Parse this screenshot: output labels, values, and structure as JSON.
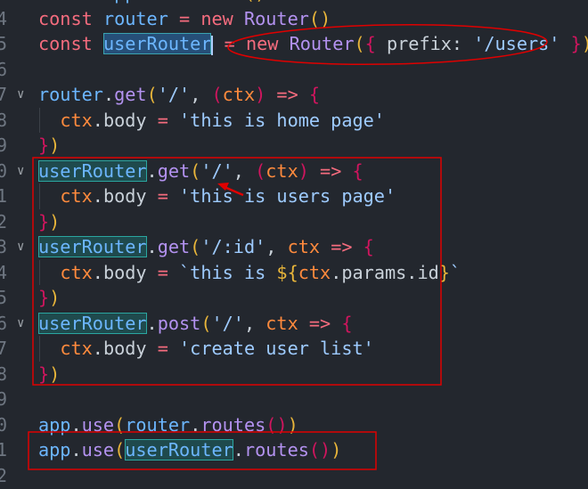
{
  "editor": {
    "lines": [
      {
        "n": "3",
        "fold": false,
        "guide": false,
        "tokens": [
          [
            "const",
            "kw"
          ],
          [
            " ",
            "pn"
          ],
          [
            "app",
            "id"
          ],
          [
            " = ",
            "op"
          ],
          [
            "new",
            "kw"
          ],
          [
            " ",
            "pn"
          ],
          [
            "Koa",
            "cls"
          ],
          [
            "(",
            "br1"
          ],
          [
            ")",
            "br1"
          ]
        ]
      },
      {
        "n": "4",
        "fold": false,
        "guide": false,
        "tokens": [
          [
            "const",
            "kw"
          ],
          [
            " ",
            "pn"
          ],
          [
            "router",
            "id"
          ],
          [
            " = ",
            "op"
          ],
          [
            "new",
            "kw"
          ],
          [
            " ",
            "pn"
          ],
          [
            "Router",
            "cls"
          ],
          [
            "(",
            "br1"
          ],
          [
            ")",
            "br1"
          ]
        ]
      },
      {
        "n": "5",
        "fold": false,
        "guide": false,
        "tokens": [
          [
            "const",
            "kw"
          ],
          [
            " ",
            "pn"
          ],
          [
            "userRouter",
            "id sel"
          ],
          [
            "",
            "cursor"
          ],
          [
            " = ",
            "op"
          ],
          [
            "new",
            "kw"
          ],
          [
            " ",
            "pn"
          ],
          [
            "Router",
            "cls"
          ],
          [
            "(",
            "br1"
          ],
          [
            "{",
            "br2"
          ],
          [
            " prefix: ",
            "prop"
          ],
          [
            "'/users'",
            "str"
          ],
          [
            " ",
            "pn"
          ],
          [
            "}",
            "br2"
          ],
          [
            ")",
            "br1"
          ]
        ]
      },
      {
        "n": "6",
        "fold": false,
        "guide": false,
        "tokens": []
      },
      {
        "n": "7",
        "fold": true,
        "guide": false,
        "tokens": [
          [
            "router",
            "id"
          ],
          [
            ".",
            "pn"
          ],
          [
            "get",
            "fn"
          ],
          [
            "(",
            "br1"
          ],
          [
            "'/'",
            "str"
          ],
          [
            ", ",
            "pn"
          ],
          [
            "(",
            "br2"
          ],
          [
            "ctx",
            "par"
          ],
          [
            ")",
            "br2"
          ],
          [
            " => ",
            "op"
          ],
          [
            "{",
            "br2"
          ]
        ]
      },
      {
        "n": "8",
        "fold": false,
        "guide": true,
        "tokens": [
          [
            "  ",
            "pn"
          ],
          [
            "ctx",
            "par"
          ],
          [
            ".",
            "pn"
          ],
          [
            "body",
            "prop"
          ],
          [
            " = ",
            "op"
          ],
          [
            "'this is home page'",
            "str"
          ]
        ]
      },
      {
        "n": "9",
        "fold": false,
        "guide": false,
        "tokens": [
          [
            "}",
            "br2"
          ],
          [
            ")",
            "br1"
          ]
        ]
      },
      {
        "n": "10",
        "fold": true,
        "guide": false,
        "tokens": [
          [
            "userRouter",
            "id hl"
          ],
          [
            ".",
            "pn"
          ],
          [
            "get",
            "fn"
          ],
          [
            "(",
            "br1"
          ],
          [
            "'/'",
            "str"
          ],
          [
            ", ",
            "pn"
          ],
          [
            "(",
            "br2"
          ],
          [
            "ctx",
            "par"
          ],
          [
            ")",
            "br2"
          ],
          [
            " => ",
            "op"
          ],
          [
            "{",
            "br2"
          ]
        ]
      },
      {
        "n": "11",
        "fold": false,
        "guide": true,
        "tokens": [
          [
            "  ",
            "pn"
          ],
          [
            "ctx",
            "par"
          ],
          [
            ".",
            "pn"
          ],
          [
            "body",
            "prop"
          ],
          [
            " = ",
            "op"
          ],
          [
            "'this is users page'",
            "str"
          ]
        ]
      },
      {
        "n": "12",
        "fold": false,
        "guide": false,
        "tokens": [
          [
            "}",
            "br2"
          ],
          [
            ")",
            "br1"
          ]
        ]
      },
      {
        "n": "13",
        "fold": true,
        "guide": false,
        "tokens": [
          [
            "userRouter",
            "id hl"
          ],
          [
            ".",
            "pn"
          ],
          [
            "get",
            "fn"
          ],
          [
            "(",
            "br1"
          ],
          [
            "'/:id'",
            "str"
          ],
          [
            ", ",
            "pn"
          ],
          [
            "ctx",
            "par"
          ],
          [
            " => ",
            "op"
          ],
          [
            "{",
            "br2"
          ]
        ]
      },
      {
        "n": "14",
        "fold": false,
        "guide": true,
        "tokens": [
          [
            "  ",
            "pn"
          ],
          [
            "ctx",
            "par"
          ],
          [
            ".",
            "pn"
          ],
          [
            "body",
            "prop"
          ],
          [
            " = ",
            "op"
          ],
          [
            "`this is ",
            "tmp"
          ],
          [
            "${",
            "br1"
          ],
          [
            "ctx",
            "par"
          ],
          [
            ".",
            "pn"
          ],
          [
            "params",
            "prop"
          ],
          [
            ".",
            "pn"
          ],
          [
            "id",
            "prop"
          ],
          [
            "}",
            "br1"
          ],
          [
            "`",
            "tmp"
          ]
        ]
      },
      {
        "n": "15",
        "fold": false,
        "guide": false,
        "tokens": [
          [
            "}",
            "br2"
          ],
          [
            ")",
            "br1"
          ]
        ]
      },
      {
        "n": "16",
        "fold": true,
        "guide": false,
        "tokens": [
          [
            "userRouter",
            "id hl"
          ],
          [
            ".",
            "pn"
          ],
          [
            "post",
            "fn"
          ],
          [
            "(",
            "br1"
          ],
          [
            "'/'",
            "str"
          ],
          [
            ", ",
            "pn"
          ],
          [
            "ctx",
            "par"
          ],
          [
            " => ",
            "op"
          ],
          [
            "{",
            "br2"
          ]
        ]
      },
      {
        "n": "17",
        "fold": false,
        "guide": true,
        "tokens": [
          [
            "  ",
            "pn"
          ],
          [
            "ctx",
            "par"
          ],
          [
            ".",
            "pn"
          ],
          [
            "body",
            "prop"
          ],
          [
            " = ",
            "op"
          ],
          [
            "'create user list'",
            "str"
          ]
        ]
      },
      {
        "n": "18",
        "fold": false,
        "guide": false,
        "tokens": [
          [
            "}",
            "br2"
          ],
          [
            ")",
            "br1"
          ]
        ]
      },
      {
        "n": "19",
        "fold": false,
        "guide": false,
        "tokens": []
      },
      {
        "n": "20",
        "fold": false,
        "guide": false,
        "tokens": [
          [
            "app",
            "id"
          ],
          [
            ".",
            "pn"
          ],
          [
            "use",
            "fn"
          ],
          [
            "(",
            "br1"
          ],
          [
            "router",
            "id"
          ],
          [
            ".",
            "pn"
          ],
          [
            "routes",
            "fn"
          ],
          [
            "(",
            "br2"
          ],
          [
            ")",
            "br2"
          ],
          [
            ")",
            "br1"
          ]
        ]
      },
      {
        "n": "21",
        "fold": false,
        "guide": false,
        "tokens": [
          [
            "app",
            "id"
          ],
          [
            ".",
            "pn"
          ],
          [
            "use",
            "fn"
          ],
          [
            "(",
            "br1"
          ],
          [
            "userRouter",
            "id hl"
          ],
          [
            ".",
            "pn"
          ],
          [
            "routes",
            "fn"
          ],
          [
            "(",
            "br2"
          ],
          [
            ")",
            "br2"
          ],
          [
            ")",
            "br1"
          ]
        ]
      },
      {
        "n": "22",
        "fold": false,
        "guide": false,
        "tokens": []
      }
    ]
  },
  "annotations": {
    "color": "#e00000",
    "shapes": [
      "ellipse-around-prefix",
      "arrow-to-slash",
      "box-around-userRouter-routes",
      "box-around-app-use-userRouter"
    ]
  }
}
